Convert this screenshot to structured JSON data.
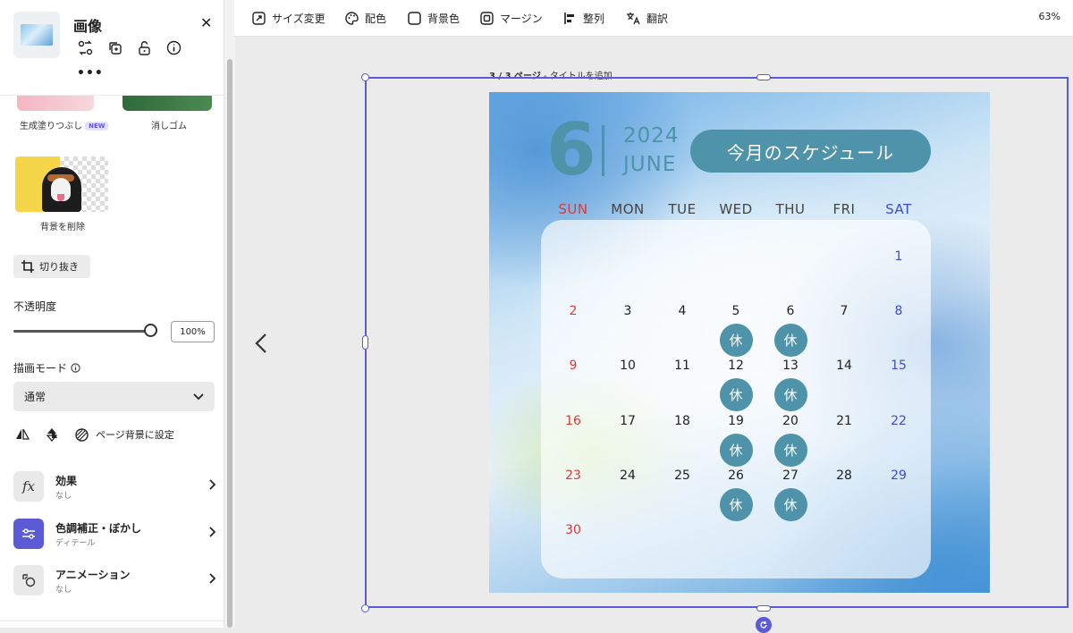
{
  "panel": {
    "title": "画像",
    "close_glyph": "✕",
    "tools": [
      {
        "icon": "replace-icon"
      },
      {
        "icon": "duplicate-icon"
      },
      {
        "icon": "unlock-icon"
      },
      {
        "icon": "info-icon"
      }
    ],
    "more_glyph": "•••",
    "tiles": [
      {
        "label": "生成塗りつぶし",
        "badge": "NEW"
      },
      {
        "label": "消しゴム"
      }
    ],
    "bg_remove_label": "背景を削除",
    "crop_label": "切り抜き",
    "opacity_label": "不透明度",
    "opacity_value": "100%",
    "opacity_fraction": 1.0,
    "blend_label": "描画モード",
    "blend_value": "通常",
    "set_page_bg_label": "ページ背景に設定",
    "rows": [
      {
        "title": "効果",
        "sub": "なし",
        "icon": "fx-icon"
      },
      {
        "title": "色調補正・ぼかし",
        "sub": "ディテール",
        "icon": "sliders-icon"
      },
      {
        "title": "アニメーション",
        "sub": "なし",
        "icon": "animation-icon"
      }
    ],
    "accent": "#5b5bd6"
  },
  "toolbar": {
    "items": [
      {
        "label": "サイズ変更",
        "icon": "resize-icon"
      },
      {
        "label": "配色",
        "icon": "palette-icon"
      },
      {
        "label": "背景色",
        "icon": "square-icon"
      },
      {
        "label": "マージン",
        "icon": "margin-icon"
      },
      {
        "label": "整列",
        "icon": "align-icon"
      },
      {
        "label": "翻訳",
        "icon": "translate-icon"
      }
    ],
    "zoom": "63%"
  },
  "canvas": {
    "page_num": "3 / 3 ページ",
    "page_title": " - タイトルを追加",
    "prev_glyph": "‹"
  },
  "calendar": {
    "month_num": "6",
    "year": "2024",
    "month_name": "JUNE",
    "headline": "今月のスケジュール",
    "weekdays": [
      "SUN",
      "MON",
      "TUE",
      "WED",
      "THU",
      "FRI",
      "SAT"
    ],
    "weeks": [
      [
        "",
        "",
        "",
        "",
        "",
        "",
        "1"
      ],
      [
        "2",
        "3",
        "4",
        "5",
        "6",
        "7",
        "8"
      ],
      [
        "9",
        "10",
        "11",
        "12",
        "13",
        "14",
        "15"
      ],
      [
        "16",
        "17",
        "18",
        "19",
        "20",
        "21",
        "22"
      ],
      [
        "23",
        "24",
        "25",
        "26",
        "27",
        "28",
        "29"
      ],
      [
        "30",
        "",
        "",
        "",
        "",
        "",
        ""
      ]
    ],
    "holiday_label": "休",
    "holidays": [
      "5",
      "6",
      "12",
      "13",
      "19",
      "20",
      "26",
      "27"
    ],
    "colors": {
      "accent": "#4e93aa",
      "sunday": "#d93a3a",
      "saturday": "#3d4bd6"
    }
  }
}
